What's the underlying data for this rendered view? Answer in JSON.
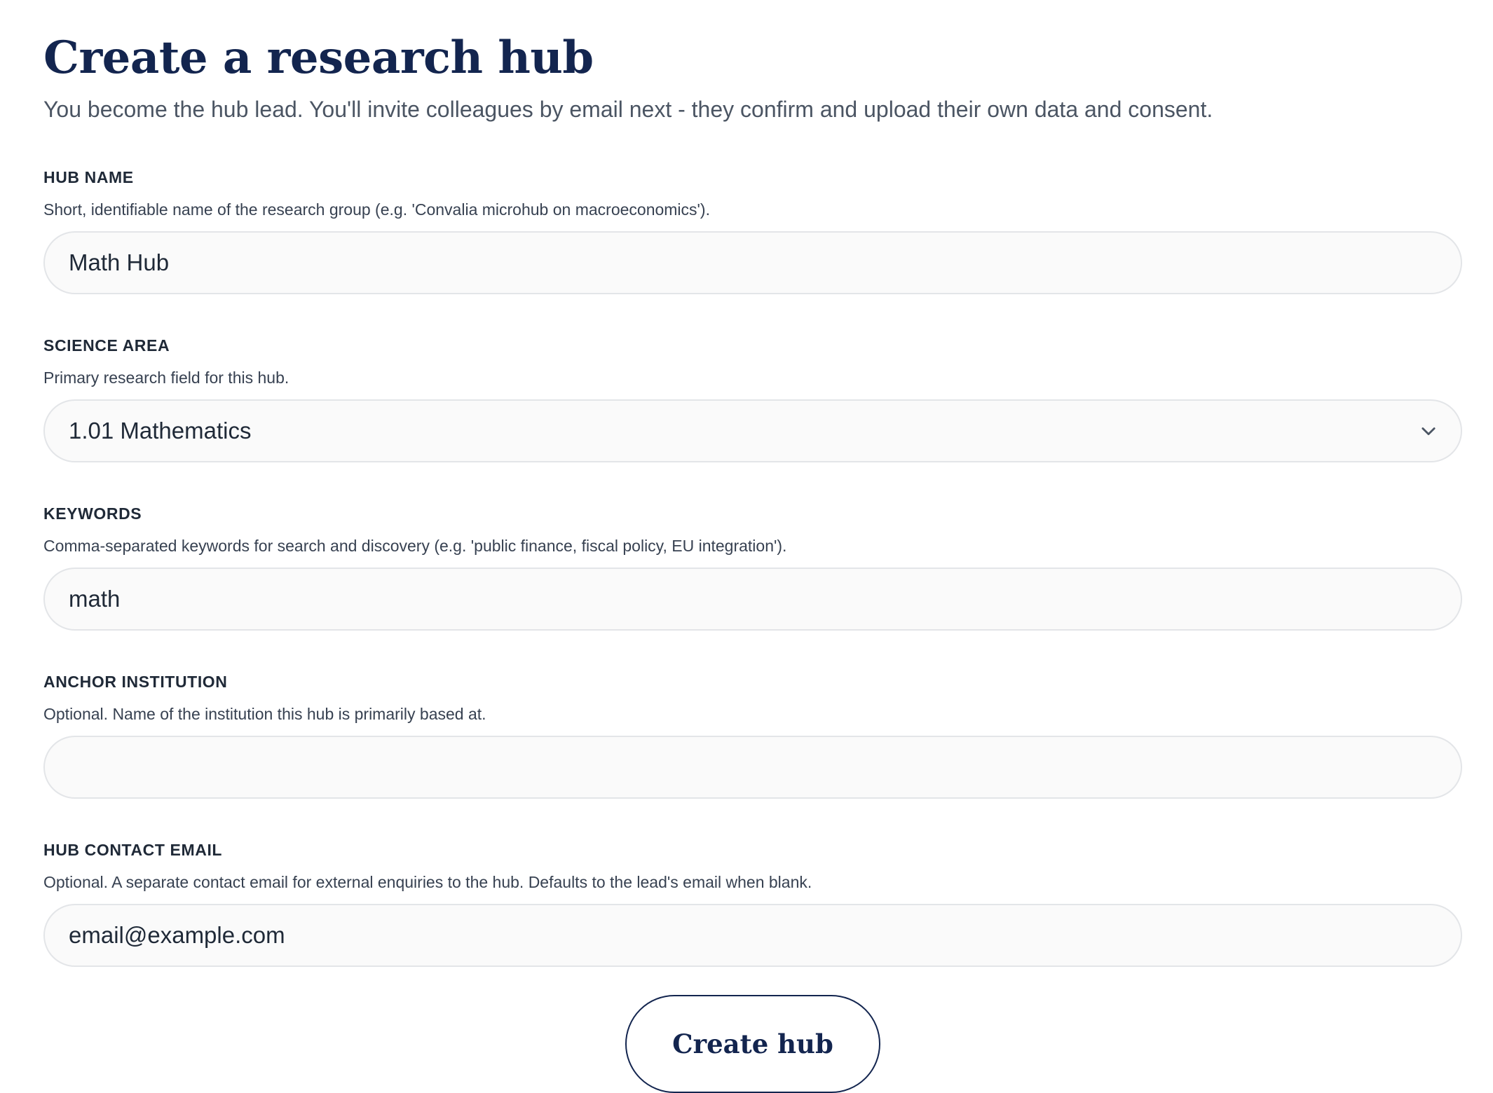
{
  "header": {
    "title": "Create a research hub",
    "subtitle": "You become the hub lead. You'll invite colleagues by email next - they confirm and upload their own data and consent."
  },
  "form": {
    "hub_name": {
      "label": "HUB NAME",
      "help": "Short, identifiable name of the research group (e.g. 'Convalia microhub on macroeconomics').",
      "value": "Math Hub"
    },
    "science_area": {
      "label": "SCIENCE AREA",
      "help": "Primary research field for this hub.",
      "selected": "1.01 Mathematics",
      "icon": "chevron-down-icon"
    },
    "keywords": {
      "label": "KEYWORDS",
      "help": "Comma-separated keywords for search and discovery (e.g. 'public finance, fiscal policy, EU integration').",
      "value": "math"
    },
    "anchor_institution": {
      "label": "ANCHOR INSTITUTION",
      "help": "Optional. Name of the institution this hub is primarily based at.",
      "value": ""
    },
    "hub_contact_email": {
      "label": "HUB CONTACT EMAIL",
      "help": "Optional. A separate contact email for external enquiries to the hub. Defaults to the lead's email when blank.",
      "value": "email@example.com"
    },
    "submit_label": "Create hub"
  },
  "colors": {
    "brand_navy": "#13254f",
    "input_background": "#fafafa",
    "input_border": "#e3e5e8"
  }
}
